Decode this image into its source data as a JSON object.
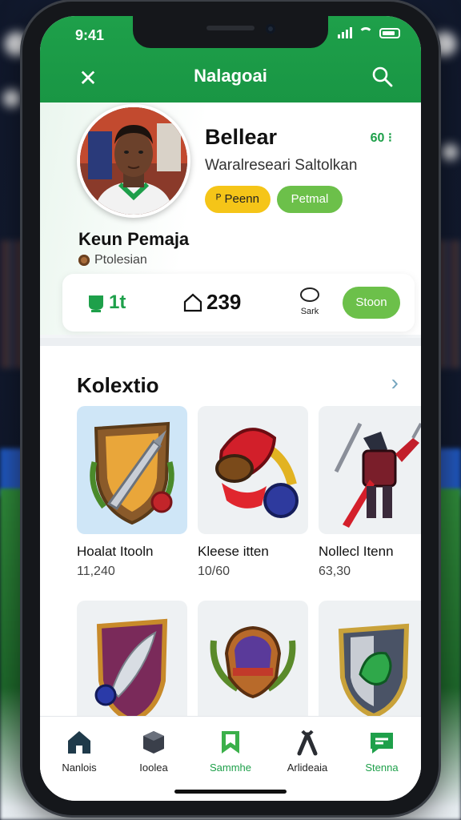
{
  "status_bar": {
    "time": "9:41"
  },
  "header": {
    "title": "Nalagoai"
  },
  "profile": {
    "name": "Bellear",
    "score": "60",
    "subtitle": "Waralreseari Saltolkan",
    "badges": [
      {
        "label": "Peenn"
      },
      {
        "label": "Petmal"
      }
    ]
  },
  "user": {
    "name": "Keun Pemaja",
    "role": "Ptolesian"
  },
  "stats": {
    "first": "1t",
    "second": "239",
    "third_label": "Sark",
    "follow_label": "Stoon"
  },
  "collection": {
    "title": "Kolextio",
    "items": [
      {
        "name": "Hoalat Itooln",
        "count": "11,240",
        "icon": "shield-sword-icon"
      },
      {
        "name": "Kleese itten",
        "count": "10/60",
        "icon": "horn-icon"
      },
      {
        "name": "Nollecl Itenn",
        "count": "63,30",
        "icon": "knight-warrior-icon"
      },
      {
        "name": "",
        "count": "",
        "icon": "feather-shield-icon"
      },
      {
        "name": "",
        "count": "",
        "icon": "helmet-laurel-icon"
      },
      {
        "name": "",
        "count": "",
        "icon": "emerald-shield-icon"
      }
    ]
  },
  "tabs": [
    {
      "label": "Nanlois",
      "icon": "home-icon"
    },
    {
      "label": "Ioolea",
      "icon": "cube-icon"
    },
    {
      "label": "Sammhe",
      "icon": "bookmark-icon"
    },
    {
      "label": "Arlideaia",
      "icon": "ribbon-icon"
    },
    {
      "label": "Stenna",
      "icon": "chat-icon"
    }
  ],
  "colors": {
    "brand": "#1ea04a",
    "accent_green": "#6cc04a",
    "accent_yellow": "#f5c518"
  }
}
